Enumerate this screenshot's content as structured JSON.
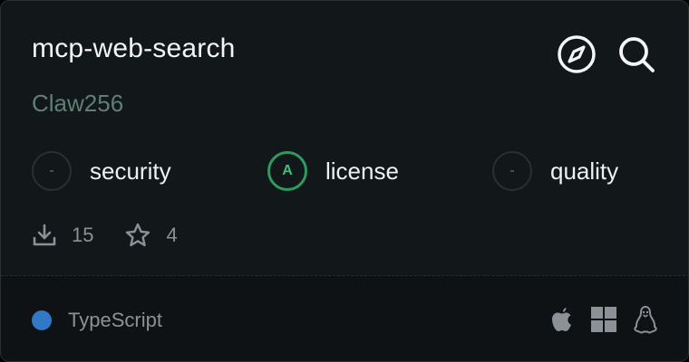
{
  "server": {
    "name": "mcp-web-search",
    "author": "Claw256"
  },
  "actions": {
    "icons": [
      "compass-icon",
      "search-icon"
    ]
  },
  "scores": [
    {
      "grade": "-",
      "label": "security"
    },
    {
      "grade": "A",
      "label": "license"
    },
    {
      "grade": "-",
      "label": "quality"
    }
  ],
  "stats": {
    "downloads": "15",
    "stars": "4"
  },
  "footer": {
    "language": "TypeScript",
    "language_color": "#3178c6",
    "platforms": [
      "apple-icon",
      "windows-icon",
      "linux-icon"
    ]
  },
  "colors": {
    "grade_a": "#3fbf77",
    "author": "#5f7f74"
  }
}
